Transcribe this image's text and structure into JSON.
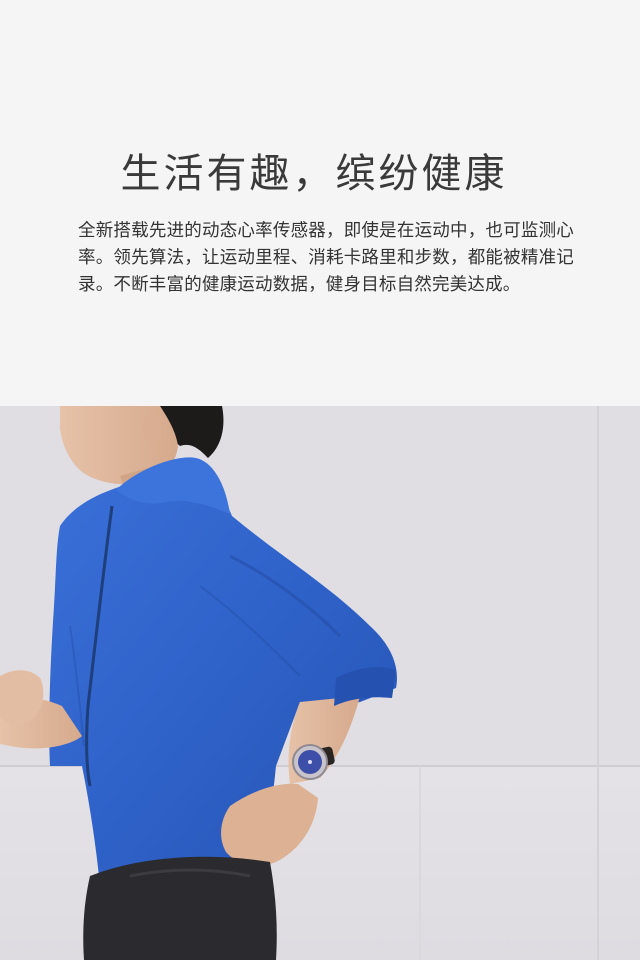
{
  "hero": {
    "headline": "生活有趣，缤纷健康",
    "body": "全新搭载先进的动态心率传感器，即使是在运动中，也可监测心率。领先算法，让运动里程、消耗卡路里和步数，都能被精准记录。不断丰富的健康运动数据，健身目标自然完美达成。"
  },
  "photo": {
    "subject": "runner-with-smartwatch"
  },
  "colors": {
    "background": "#f5f5f5",
    "headline": "#3a3a3a",
    "body": "#333333",
    "jacket": "#2f62c9",
    "wall": "#e0dee3"
  }
}
